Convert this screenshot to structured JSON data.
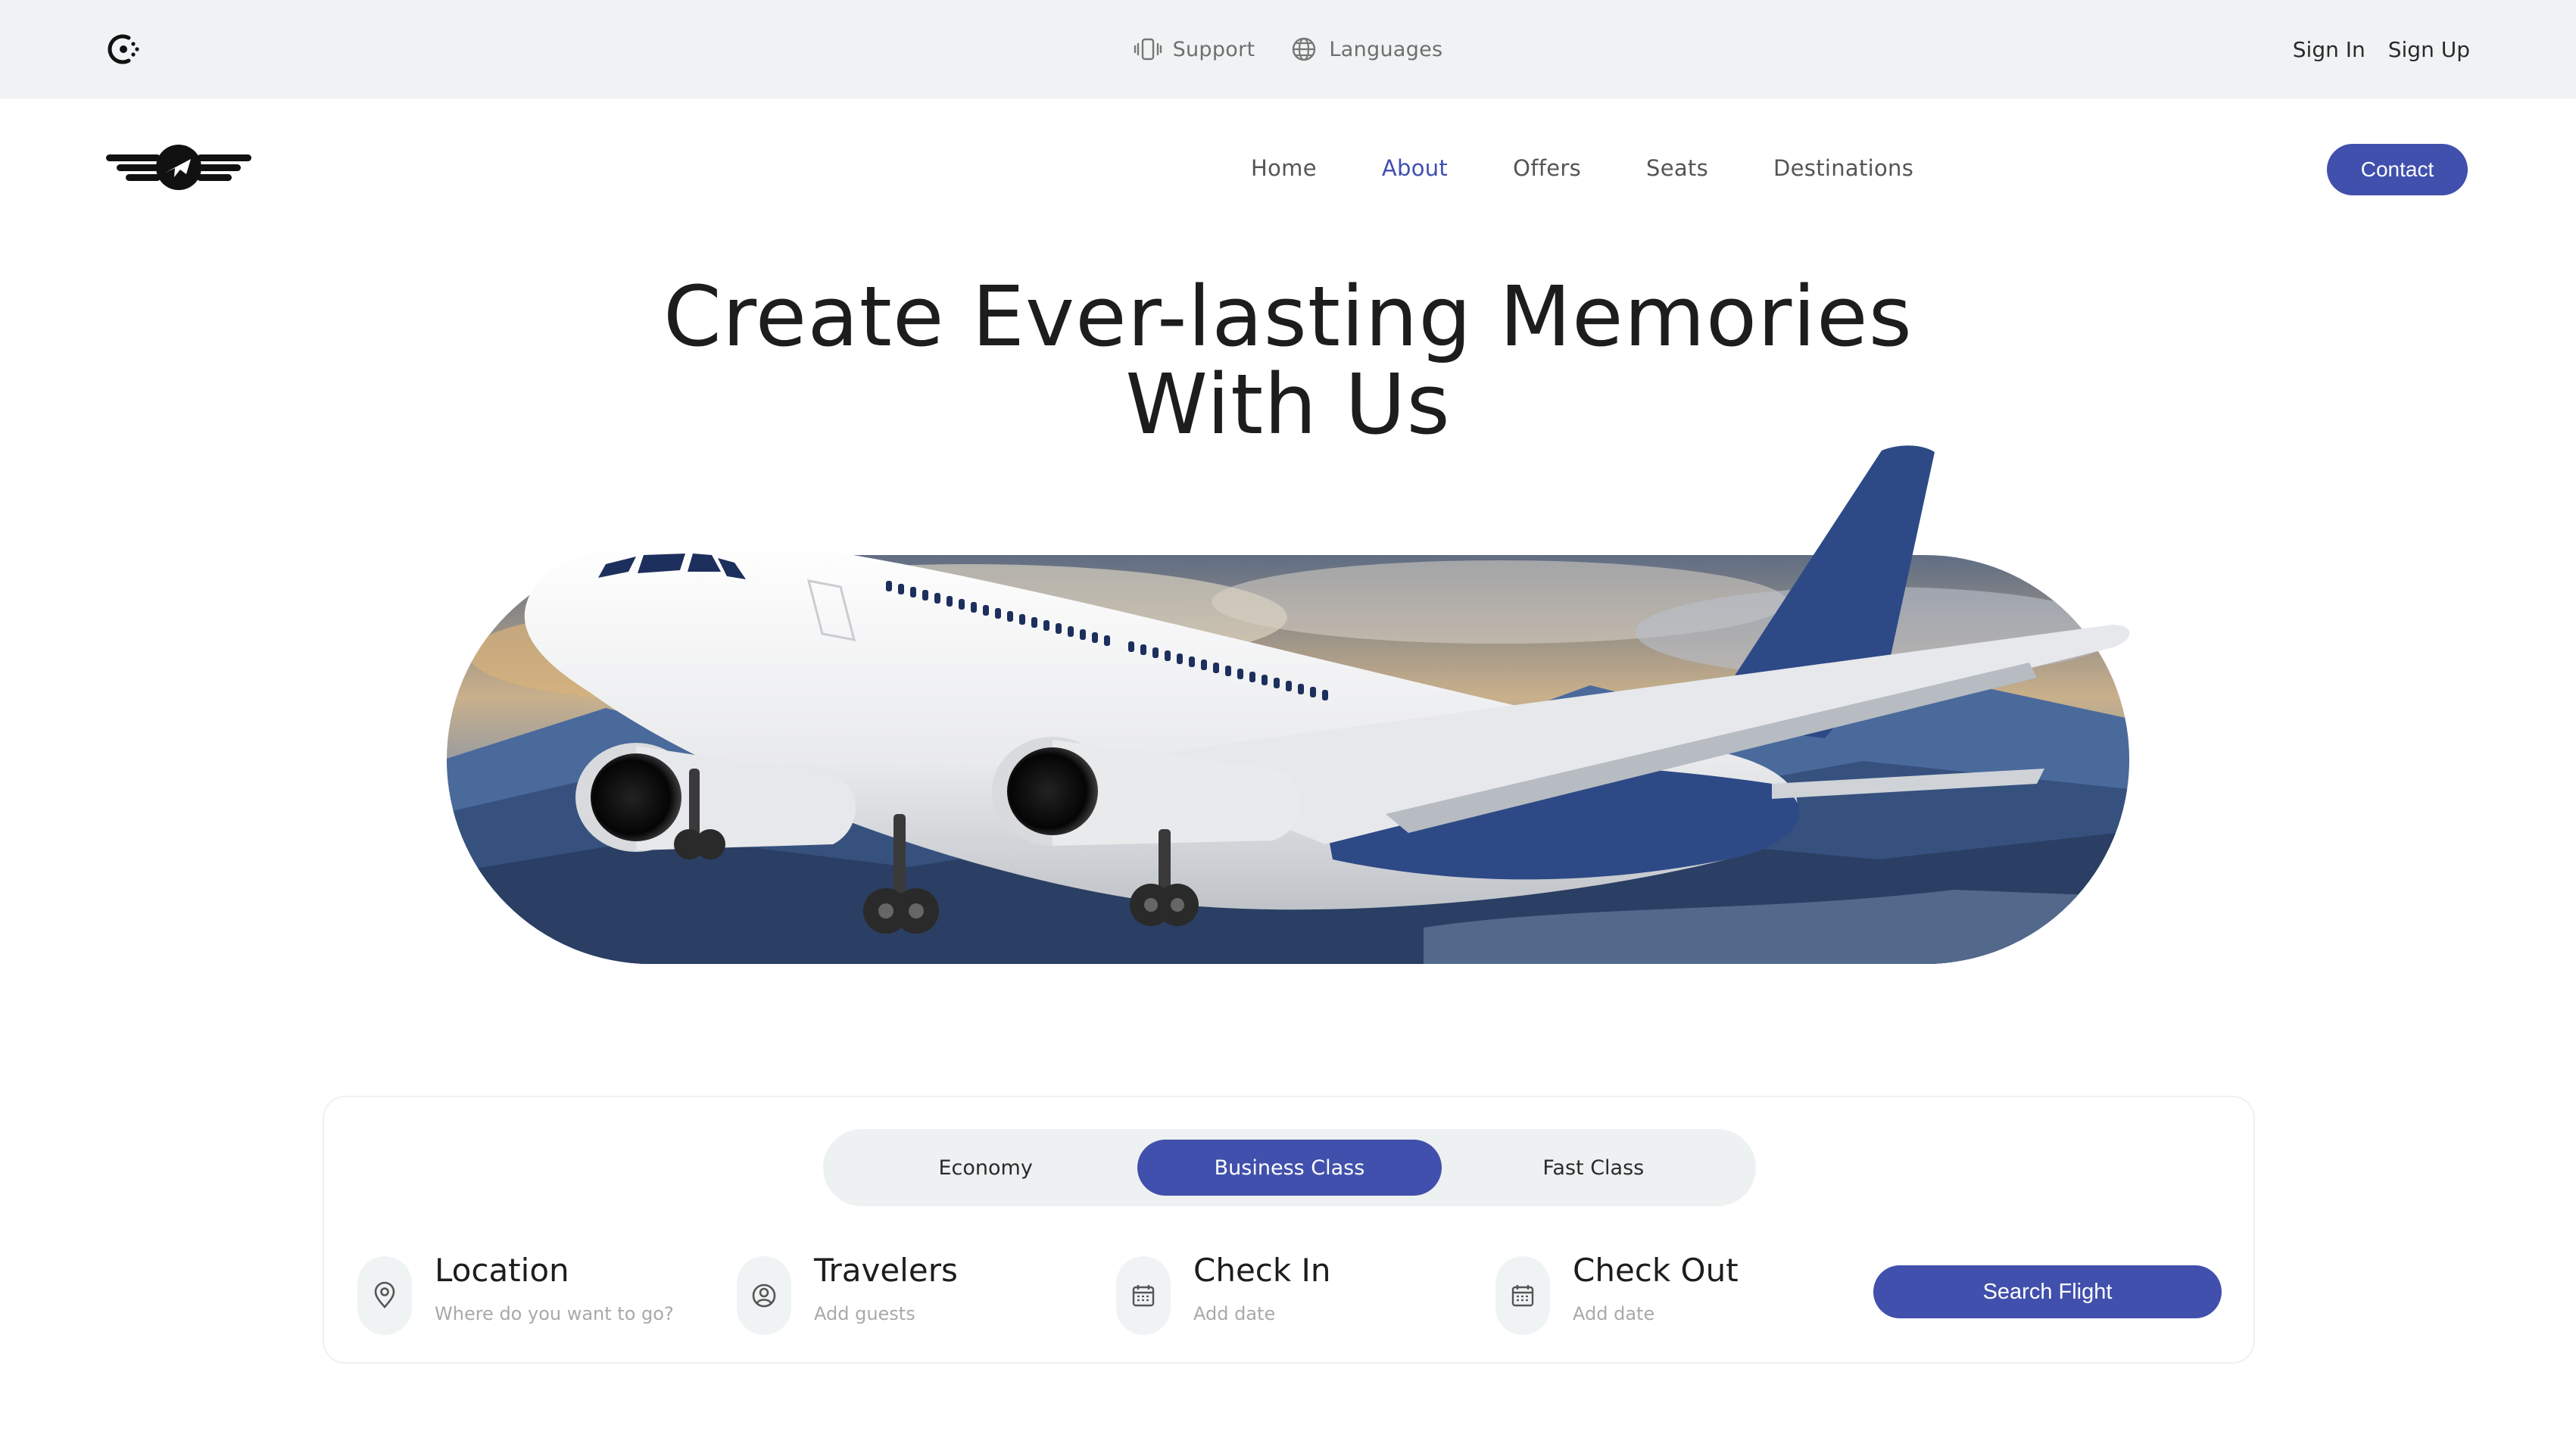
{
  "topbar": {
    "logo_icon": "circle-dots-logo-icon",
    "support": {
      "label": "Support",
      "icon": "phone-vibrate-icon"
    },
    "languages": {
      "label": "Languages",
      "icon": "globe-icon"
    },
    "sign_in": "Sign In",
    "sign_up": "Sign Up"
  },
  "nav": {
    "brand_icon": "winged-plane-logo-icon",
    "items": [
      {
        "label": "Home"
      },
      {
        "label": "About"
      },
      {
        "label": "Offers"
      },
      {
        "label": "Seats"
      },
      {
        "label": "Destinations"
      }
    ],
    "active": "About",
    "contact": "Contact"
  },
  "hero": {
    "title_line1": "Create Ever-lasting Memories",
    "title_line2": "With Us",
    "image": "airplane-over-mountains-illustration"
  },
  "search": {
    "tabs": [
      {
        "label": "Economy"
      },
      {
        "label": "Business Class"
      },
      {
        "label": "Fast Class"
      }
    ],
    "active_tab": "Business Class",
    "fields": {
      "location": {
        "label": "Location",
        "placeholder": "Where do you want to go?",
        "icon": "map-pin-icon"
      },
      "travelers": {
        "label": "Travelers",
        "placeholder": "Add guests",
        "icon": "user-circle-icon"
      },
      "check_in": {
        "label": "Check In",
        "placeholder": "Add date",
        "icon": "calendar-icon"
      },
      "check_out": {
        "label": "Check Out",
        "placeholder": "Add date",
        "icon": "calendar-icon"
      }
    },
    "submit": "Search Flight"
  },
  "colors": {
    "accent": "#4150ac",
    "topbar_bg": "#f0f3f4",
    "plane_tail": "#2d4a86"
  }
}
